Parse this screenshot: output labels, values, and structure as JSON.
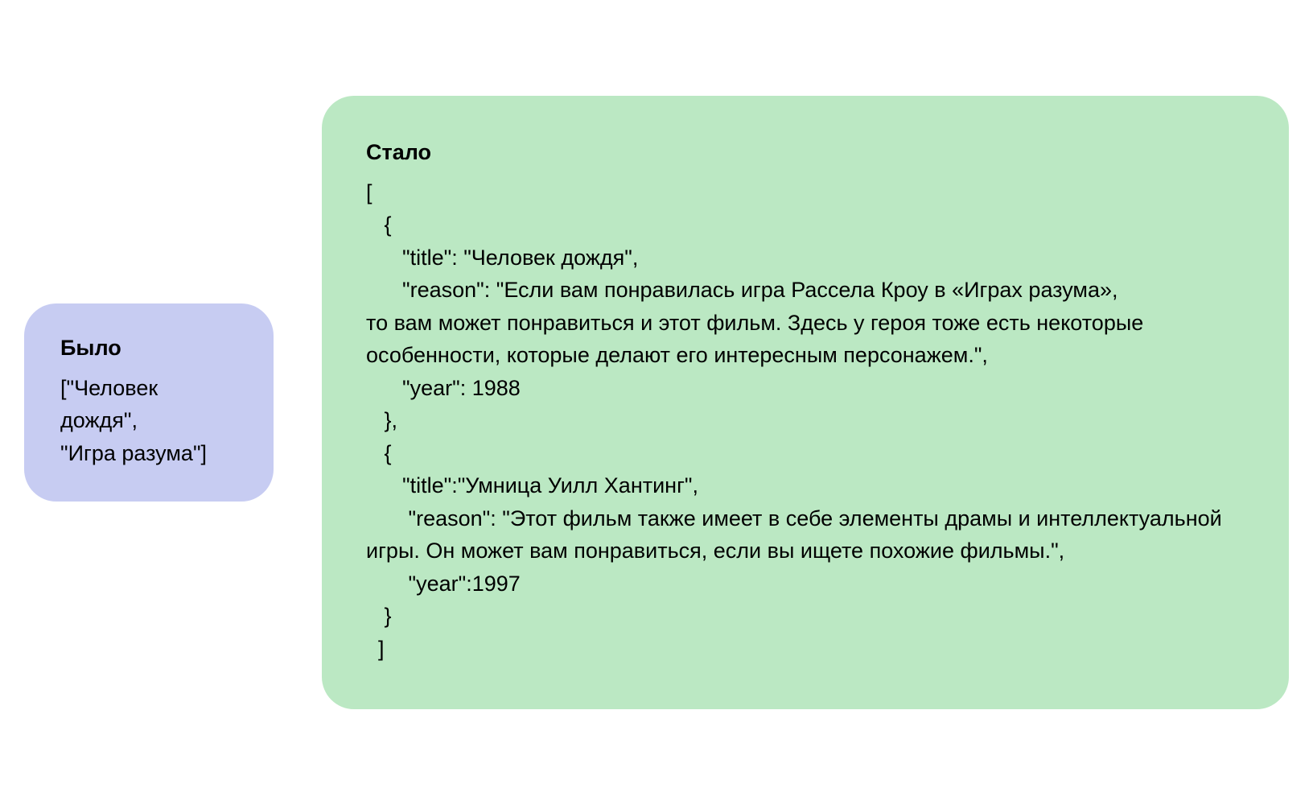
{
  "before": {
    "title": "Было",
    "content": "[\"Человек дождя\",\n\"Игра разума\"]"
  },
  "after": {
    "title": "Стало",
    "content": "[\n   {\n      \"title\": \"Человек дождя\",\n      \"reason\": \"Если вам понравилась игра Рассела Кроу в «Играх разума»,\nто вам может понравиться и этот фильм. Здесь у героя тоже есть некоторые особенности, которые делают его интересным персонажем.\",\n      \"year\": 1988\n   },\n   {\n      \"title\":\"Умница Уилл Хантинг\",\n       \"reason\": \"Этот фильм также имеет в себе элементы драмы и интеллектуальной игры. Он может вам понравиться, если вы ищете похожие фильмы.\",\n       \"year\":1997\n   }\n  ]"
  }
}
